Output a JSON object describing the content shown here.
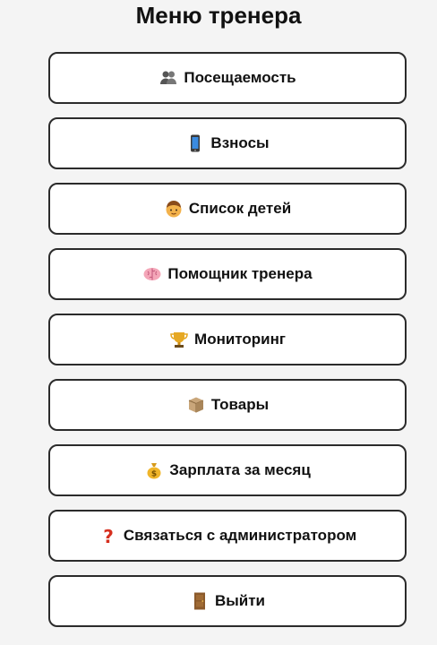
{
  "header": {
    "title": "Меню тренера"
  },
  "menu": {
    "items": [
      {
        "label": "Посещаемость",
        "icon": "people-icon"
      },
      {
        "label": "Взносы",
        "icon": "mobile-phone-icon"
      },
      {
        "label": "Список детей",
        "icon": "child-icon"
      },
      {
        "label": "Помощник тренера",
        "icon": "brain-icon"
      },
      {
        "label": "Мониторинг",
        "icon": "trophy-icon"
      },
      {
        "label": "Товары",
        "icon": "package-icon"
      },
      {
        "label": "Зарплата за месяц",
        "icon": "money-bag-icon"
      },
      {
        "label": "Связаться с администратором",
        "icon": "question-mark-icon"
      },
      {
        "label": "Выйти",
        "icon": "door-icon"
      }
    ]
  }
}
